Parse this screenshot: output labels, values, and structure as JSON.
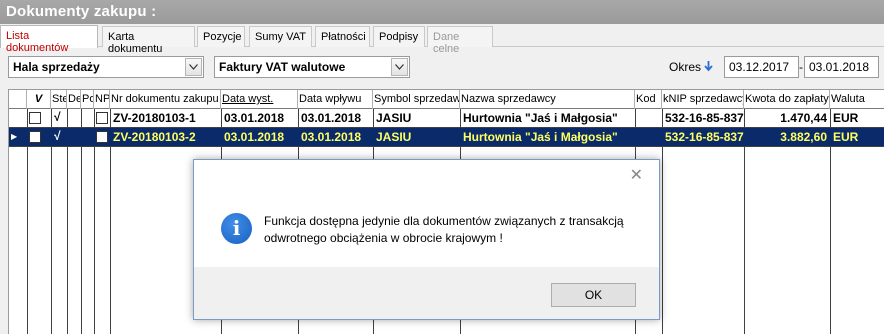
{
  "window": {
    "title": "Dokumenty zakupu :"
  },
  "tabs": [
    {
      "label": "Lista dokumentów",
      "state": "active"
    },
    {
      "label": "Karta dokumentu",
      "state": "normal"
    },
    {
      "label": "Pozycje",
      "state": "normal"
    },
    {
      "label": "Sumy VAT",
      "state": "normal"
    },
    {
      "label": "Płatności",
      "state": "normal"
    },
    {
      "label": "Podpisy",
      "state": "normal"
    },
    {
      "label": "Dane celne",
      "state": "disabled"
    }
  ],
  "filters": {
    "location": "Hala sprzedaży",
    "doc_type": "Faktury VAT walutowe",
    "okres_label": "Okres",
    "date_from": "03.12.2017",
    "date_to": "03.01.2018",
    "dash": "-"
  },
  "table": {
    "columns": [
      "V",
      "Ste",
      "De",
      "Po",
      "NP",
      "Nr dokumentu zakupu",
      "Data wyst.",
      "Data wpływu",
      "Symbol sprzedawcy",
      "Nazwa sprzedawcy",
      "Kod",
      "kNIP sprzedawcy",
      "Kwota do zapłaty",
      "Waluta"
    ],
    "rows": [
      {
        "nr": "ZV-20180103-1",
        "data_wyst": "03.01.2018",
        "data_wplywu": "03.01.2018",
        "symbol": "JASIU",
        "nazwa": "Hurtownia \"Jaś i Małgosia\"",
        "nip": "532-16-85-837",
        "kwota": "1.470,44",
        "waluta": "EUR",
        "check_mark": "√",
        "selected": false
      },
      {
        "nr": "ZV-20180103-2",
        "data_wyst": "03.01.2018",
        "data_wplywu": "03.01.2018",
        "symbol": "JASIU",
        "nazwa": "Hurtownia \"Jaś i Małgosia\"",
        "nip": "532-16-85-837",
        "kwota": "3.882,60",
        "waluta": "EUR",
        "check_mark": "√",
        "selected": true
      }
    ]
  },
  "dialog": {
    "message": "Funkcja dostępna jedynie dla dokumentów związanych z transakcją odwrotnego obciążenia w obrocie krajowym !",
    "ok_label": "OK",
    "close_glyph": "✕",
    "icon": "info-icon",
    "icon_glyph": "i"
  },
  "colors": {
    "selected_row_bg": "#0a2a6a",
    "active_tab_text": "#c00000",
    "title_bg": "#a0a0a0"
  }
}
